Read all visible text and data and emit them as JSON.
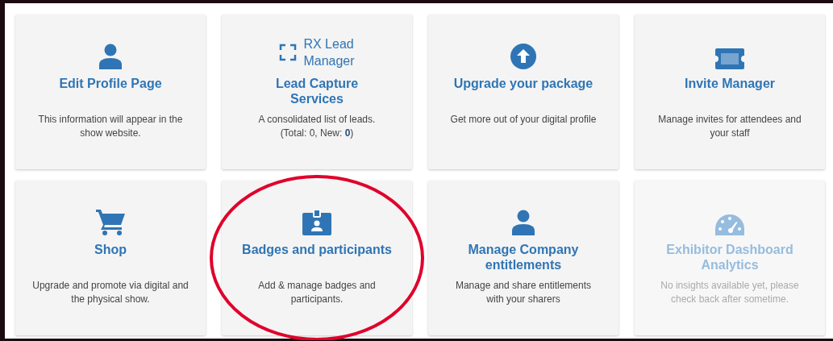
{
  "cards": [
    {
      "kind": "person",
      "title": "Edit Profile Page",
      "description": "This information will appear in the\nshow website.",
      "disabled": false,
      "highlighted": false
    },
    {
      "kind": "scan",
      "logo_text": "RX Lead\nManager",
      "title": "Lead Capture\nServices",
      "description": "A consolidated list of leads.\n(Total: 0, New: **0**)",
      "disabled": false,
      "highlighted": false
    },
    {
      "kind": "upgrade",
      "title": "Upgrade your package",
      "description": "Get more out of your digital profile",
      "disabled": false,
      "highlighted": false
    },
    {
      "kind": "ticket",
      "title": "Invite Manager",
      "description": "Manage invites for attendees and\nyour staff",
      "disabled": false,
      "highlighted": false
    },
    {
      "kind": "cart",
      "title": "Shop",
      "description": "Upgrade and promote via digital and\nthe physical show.",
      "disabled": false,
      "highlighted": false
    },
    {
      "kind": "badge",
      "title": "Badges and participants",
      "description": "Add & manage badges and\nparticipants.",
      "disabled": false,
      "highlighted": true
    },
    {
      "kind": "person",
      "title": "Manage Company\nentitlements",
      "description": "Manage and share entitlements\nwith your sharers",
      "disabled": false,
      "highlighted": false
    },
    {
      "kind": "gauge",
      "title": "Exhibitor Dashboard\nAnalytics",
      "description": "No insights available yet, please\ncheck back after sometime.",
      "disabled": true,
      "highlighted": false
    }
  ]
}
